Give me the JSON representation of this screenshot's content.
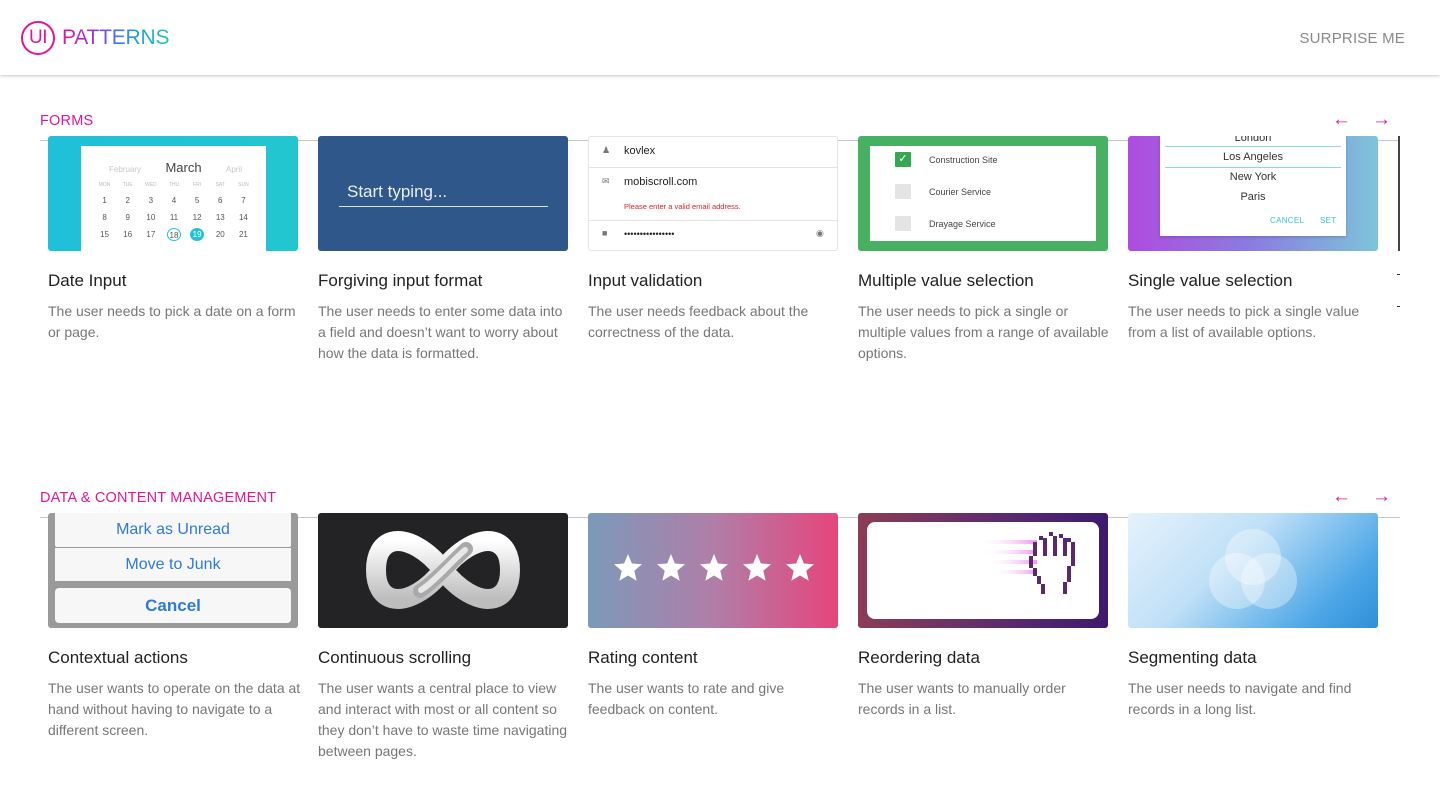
{
  "header": {
    "logo_mark": "UI",
    "logo_text": "PATTERNS",
    "surprise_label": "SURPRISE ME"
  },
  "colors": {
    "accent": "#e0169a",
    "text": "#222222",
    "muted": "#777777"
  },
  "sections": [
    {
      "title": "FORMS",
      "prev_icon": "arrow-left-icon",
      "next_icon": "arrow-right-icon",
      "cards": [
        {
          "title": "Date Input",
          "desc": "The user needs to pick a date on a form or page."
        },
        {
          "title": "Forgiving input format",
          "desc": "The user needs to enter some data into a field and doesn’t want to worry about how the data is formatted."
        },
        {
          "title": "Input validation",
          "desc": "The user needs feedback about the correctness of the data."
        },
        {
          "title": "Multiple value selection",
          "desc": "The user needs to pick a single or multiple values from a range of available options."
        },
        {
          "title": "Single value selection",
          "desc": "The user needs to pick a single value from a list of available options."
        }
      ]
    },
    {
      "title": "DATA & CONTENT MANAGEMENT",
      "prev_icon": "arrow-left-icon",
      "next_icon": "arrow-right-icon",
      "cards": [
        {
          "title": "Contextual actions",
          "desc": "The user wants to operate on the data at hand without having to navigate to a different screen."
        },
        {
          "title": "Continuous scrolling",
          "desc": "The user wants a central place to view and interact with most or all content so they don’t have to waste time navigating between pages."
        },
        {
          "title": "Rating content",
          "desc": "The user wants to rate and give feedback on content."
        },
        {
          "title": "Reordering data",
          "desc": "The user wants to manually order records in a list."
        },
        {
          "title": "Segmenting data",
          "desc": "The user needs to navigate and find records in a long list."
        }
      ]
    }
  ],
  "thumbs": {
    "date": {
      "prev_month": "February",
      "month": "March",
      "next_month": "April",
      "dow": [
        "MON",
        "TUE",
        "WED",
        "THU",
        "FRI",
        "SAT",
        "SUN"
      ],
      "days": [
        "1",
        "2",
        "3",
        "4",
        "5",
        "6",
        "7",
        "8",
        "9",
        "10",
        "11",
        "12",
        "13",
        "14",
        "15",
        "16",
        "17",
        "18",
        "19",
        "20",
        "21"
      ],
      "today": "18",
      "selected": "19"
    },
    "forgiving": {
      "placeholder": "Start typing..."
    },
    "validation": {
      "username": "kovlex",
      "email": "mobiscroll.com",
      "error": "Please enter a valid email address.",
      "password": "••••••••••••••••"
    },
    "multiple": {
      "options": [
        "Construction Site",
        "Courier Service",
        "Drayage Service"
      ],
      "checked": "Construction Site"
    },
    "single": {
      "options": [
        "London",
        "Los Angeles",
        "New York",
        "Paris"
      ],
      "selected": "Los Angeles",
      "cancel": "CANCEL",
      "set": "SET"
    },
    "contextual": {
      "actions": [
        "Mark as Unread",
        "Move to Junk"
      ],
      "cancel": "Cancel"
    },
    "rating": {
      "stars": 5
    }
  }
}
